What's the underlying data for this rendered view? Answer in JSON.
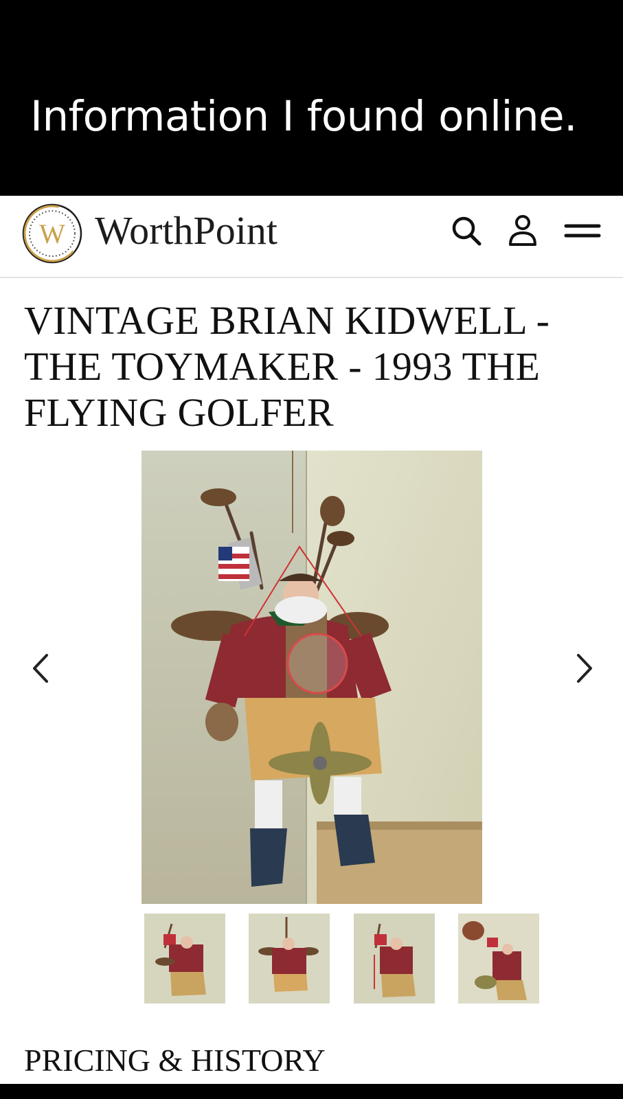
{
  "banner": {
    "caption": "Information I found online."
  },
  "header": {
    "brand": "WorthPoint",
    "logo_letter": "W",
    "icons": [
      "search-icon",
      "user-icon",
      "menu-icon"
    ]
  },
  "listing": {
    "title": "VINTAGE BRIAN KIDWELL - THE TOYMAKER - 1993 THE FLYING GOLFER",
    "gallery": {
      "thumbnail_count": 4,
      "selected_index": 1
    }
  },
  "sections": {
    "pricing_history": "PRICING & HISTORY"
  },
  "colors": {
    "banner_bg": "#000000",
    "banner_text": "#ffffff",
    "logo_gold": "#c9a04a",
    "text_dark": "#111111",
    "photo_wall": "#dcdcc4"
  }
}
